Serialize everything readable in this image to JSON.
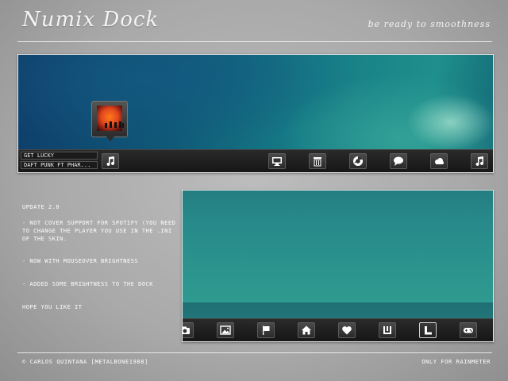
{
  "header": {
    "title": "Numix Dock",
    "tagline": "be ready to smoothness"
  },
  "top_panel": {
    "now_playing": {
      "track": "GET LUCKY",
      "artist": "DAFT PUNK FT PHAR..."
    },
    "dock_icons": [
      "music-note-icon",
      "monitor-icon",
      "trash-icon",
      "chrome-icon",
      "chat-bubble-icon",
      "cloud-icon",
      "music-note-icon"
    ]
  },
  "notes": {
    "heading": "UPDATE 2.0",
    "items": [
      "- NOT COVER SUPPORT FOR SPOTIFY (YOU NEED TO CHANGE THE PLAYER YOU USE IN THE .INI OF THE SKIN.",
      "- NOW WITH MOUSEOVER BRIGHTNESS",
      "- ADDED SOME BRIGHTNESS TO THE DOCK"
    ],
    "closing": "HOPE YOU LIKE IT"
  },
  "bottom_panel": {
    "dock_icons": [
      "camera-icon",
      "image-icon",
      "flag-icon",
      "home-icon",
      "heart-icon",
      "download-icon",
      "l-shape-icon",
      "gamepad-icon"
    ],
    "active_icon": "l-shape-icon"
  },
  "footer": {
    "credit": "© CARLOS QUINTANA [METALBONE1988]",
    "note": "ONLY FOR RAINMETER"
  },
  "colors": {
    "background": "#a9a9a9",
    "dock": "#1f1f1f",
    "text": "#ffffff"
  }
}
